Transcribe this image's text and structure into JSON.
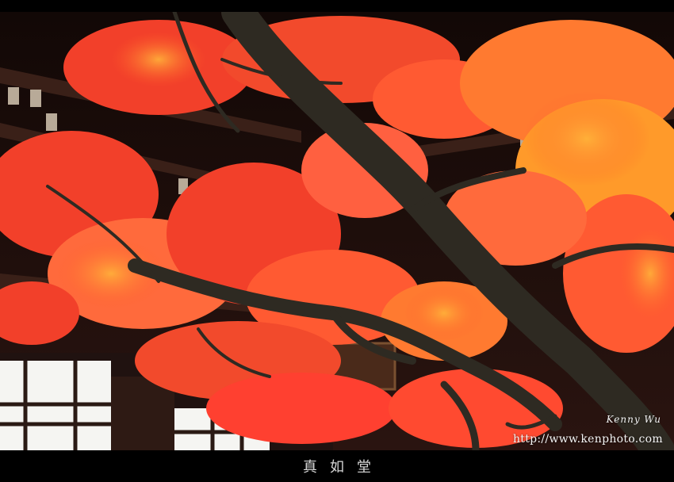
{
  "photo": {
    "subject": "temple-with-maple-tree",
    "colors": {
      "foliage_main": "#f2402a",
      "foliage_bright": "#ff6a3c",
      "foliage_orange": "#ff9a2a",
      "foliage_yellow": "#ffc23a",
      "branch": "#2e2a22",
      "temple_dark": "#1a0f0c",
      "temple_wood": "#3a2018",
      "window_white": "#f5f5f2"
    }
  },
  "watermark": {
    "name": "Kenny Wu",
    "url": "http://www.kenphoto.com"
  },
  "caption": {
    "text": "真如堂"
  }
}
